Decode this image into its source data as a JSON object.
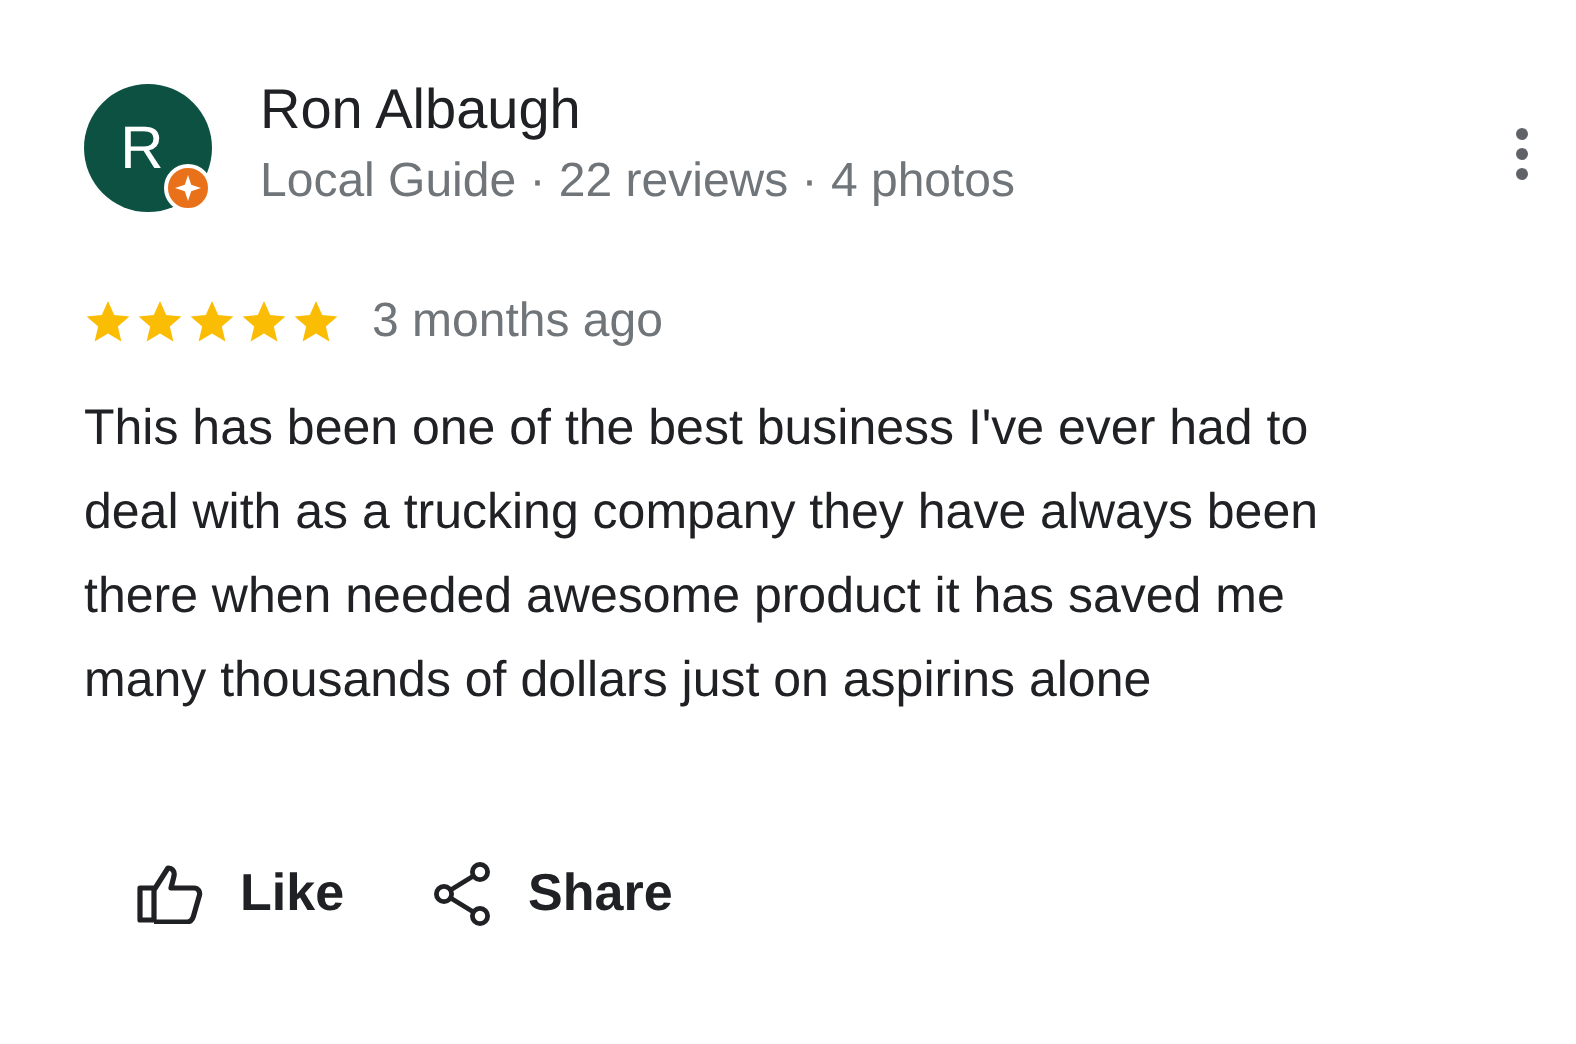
{
  "reviewer": {
    "initial": "R",
    "name": "Ron Albaugh",
    "details": "Local Guide · 22 reviews · 4 photos",
    "local_guide": true
  },
  "review": {
    "stars": 5,
    "age": "3 months ago",
    "text": "This has been one of the best business I've ever had to deal with as a trucking company they have always been there when needed awesome product it has saved me many thousands of dollars just on aspirins alone"
  },
  "actions": [
    {
      "kind": "like",
      "label": "Like"
    },
    {
      "kind": "share",
      "label": "Share"
    }
  ]
}
